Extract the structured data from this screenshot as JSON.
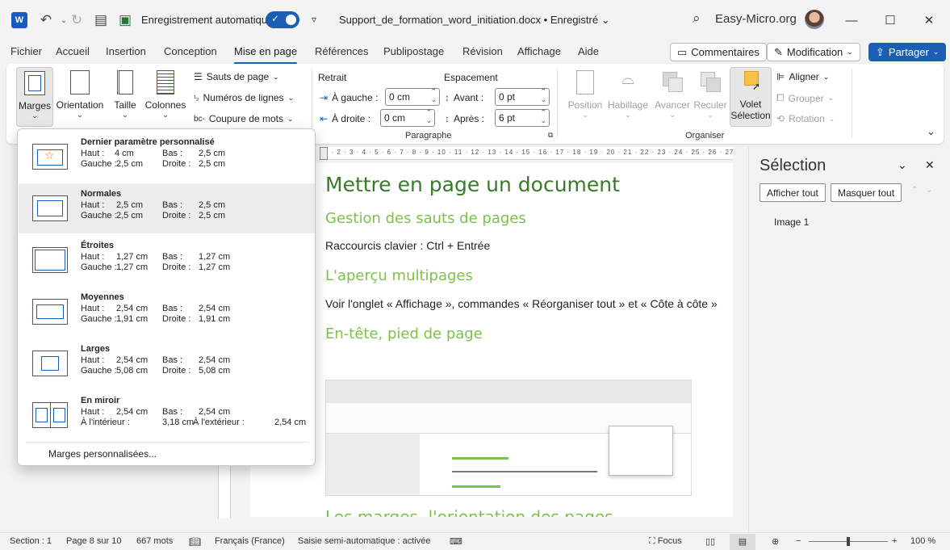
{
  "title_bar": {
    "app_logo": "W",
    "autosave_label": "Enregistrement automatique",
    "doc_title": "Support_de_formation_word_initiation.docx",
    "saved_status": "• Enregistré",
    "account": "Easy-Micro.org"
  },
  "tabs": [
    "Fichier",
    "Accueil",
    "Insertion",
    "Conception",
    "Mise en page",
    "Références",
    "Publipostage",
    "Révision",
    "Affichage",
    "Aide"
  ],
  "active_tab": "Mise en page",
  "header_buttons": {
    "comments": "Commentaires",
    "editing": "Modification",
    "share": "Partager"
  },
  "ribbon": {
    "margins": "Marges",
    "orientation": "Orientation",
    "size": "Taille",
    "columns": "Colonnes",
    "breaks": "Sauts de page",
    "line_numbers": "Numéros de lignes",
    "hyphenation": "Coupure de mots",
    "indent_title": "Retrait",
    "indent_left": "À gauche :",
    "indent_left_value": "0 cm",
    "indent_right": "À droite :",
    "indent_right_value": "0 cm",
    "spacing_title": "Espacement",
    "spacing_before": "Avant :",
    "spacing_before_value": "0 pt",
    "spacing_after": "Après :",
    "spacing_after_value": "6 pt",
    "paragraph_group": "Paragraphe",
    "position": "Position",
    "wrap": "Habillage",
    "forward": "Avancer",
    "backward": "Reculer",
    "selection_pane_1": "Volet",
    "selection_pane_2": "Sélection",
    "align": "Aligner",
    "group": "Grouper",
    "rotate": "Rotation",
    "arrange_group": "Organiser"
  },
  "margins_menu": {
    "items": [
      {
        "title": "Dernier paramètre personnalisé",
        "top": "4 cm",
        "bottom": "2,5 cm",
        "left": "2,5 cm",
        "right": "2,5 cm"
      },
      {
        "title": "Normales",
        "top": "2,5 cm",
        "bottom": "2,5 cm",
        "left": "2,5 cm",
        "right": "2,5 cm"
      },
      {
        "title": "Étroites",
        "top": "1,27 cm",
        "bottom": "1,27 cm",
        "left": "1,27 cm",
        "right": "1,27 cm"
      },
      {
        "title": "Moyennes",
        "top": "2,54 cm",
        "bottom": "2,54 cm",
        "left": "1,91 cm",
        "right": "1,91 cm"
      },
      {
        "title": "Larges",
        "top": "2,54 cm",
        "bottom": "2,54 cm",
        "left": "5,08 cm",
        "right": "5,08 cm"
      }
    ],
    "mirror": {
      "title": "En miroir",
      "top": "2,54 cm",
      "bottom": "2,54 cm",
      "inside_label": "À l'intérieur :",
      "inside": "3,18 cm",
      "outside_label": "À l'extérieur :",
      "outside": "2,54 cm"
    },
    "labels": {
      "top": "Haut :",
      "bottom": "Bas :",
      "left": "Gauche :",
      "right": "Droite :"
    },
    "custom": "Marges personnalisées..."
  },
  "document": {
    "h1": "Mettre en page un document",
    "h2_a": "Gestion des sauts de pages",
    "p_a": "Raccourcis clavier : Ctrl + Entrée",
    "h2_b": "L'aperçu multipages",
    "p_b": "Voir l'onglet « Affichage », commandes « Réorganiser tout » et « Côte à côte »",
    "h2_c": "En-tête, pied de page",
    "h2_d": "Les marges, l'orientation des pages"
  },
  "selection_pane": {
    "title": "Sélection",
    "show_all": "Afficher tout",
    "hide_all": "Masquer tout",
    "item": "Image 1"
  },
  "status": {
    "section": "Section : 1",
    "page": "Page 8 sur 10",
    "words": "667 mots",
    "language": "Français (France)",
    "autocomplete": "Saisie semi-automatique : activée",
    "focus": "Focus",
    "zoom": "100 %"
  }
}
